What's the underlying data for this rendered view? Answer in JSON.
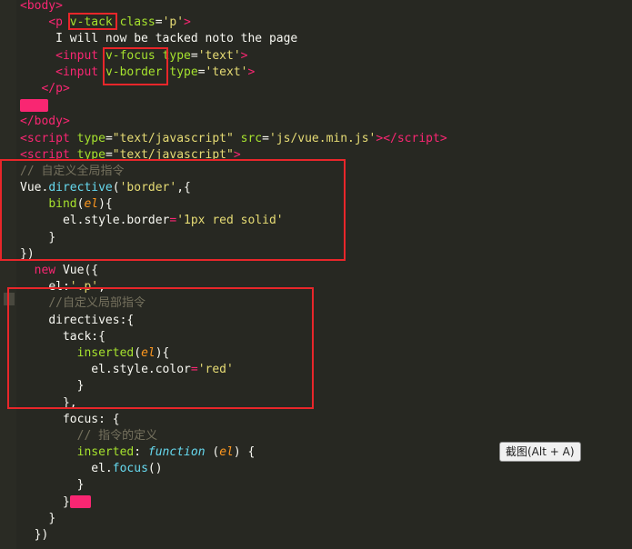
{
  "lines": [
    {
      "indent": "",
      "tokens": [
        [
          "tag",
          "<body>"
        ]
      ]
    },
    {
      "indent": "    ",
      "tokens": [
        [
          "tag",
          "<p "
        ],
        [
          "attr",
          "v-tack"
        ],
        [
          "plain",
          " "
        ],
        [
          "attr",
          "class"
        ],
        [
          "plain",
          "="
        ],
        [
          "str",
          "'p'"
        ],
        [
          "tag",
          ">"
        ]
      ]
    },
    {
      "indent": "     ",
      "tokens": [
        [
          "plain",
          "I will now be tacked noto the page"
        ]
      ]
    },
    {
      "indent": "     ",
      "tokens": [
        [
          "tag",
          "<input "
        ],
        [
          "attr",
          "v-focus"
        ],
        [
          "plain",
          " "
        ],
        [
          "attr",
          "type"
        ],
        [
          "plain",
          "="
        ],
        [
          "str",
          "'text'"
        ],
        [
          "tag",
          ">"
        ]
      ]
    },
    {
      "indent": "     ",
      "tokens": [
        [
          "tag",
          "<input "
        ],
        [
          "attr",
          "v-border"
        ],
        [
          "plain",
          " "
        ],
        [
          "attr",
          "type"
        ],
        [
          "plain",
          "="
        ],
        [
          "str",
          "'text'"
        ],
        [
          "tag",
          ">"
        ]
      ]
    },
    {
      "indent": "   ",
      "tokens": [
        [
          "tag",
          "</p>"
        ]
      ]
    },
    {
      "indent": "",
      "tokens": [
        [
          "mark",
          "...."
        ]
      ]
    },
    {
      "indent": "",
      "tokens": [
        [
          "tag",
          "</body>"
        ]
      ]
    },
    {
      "indent": "",
      "tokens": [
        [
          "tag",
          "<script "
        ],
        [
          "attr",
          "type"
        ],
        [
          "plain",
          "="
        ],
        [
          "str",
          "\"text/javascript\""
        ],
        [
          "plain",
          " "
        ],
        [
          "attr",
          "src"
        ],
        [
          "plain",
          "="
        ],
        [
          "str",
          "'js/vue.min.js'"
        ],
        [
          "tag",
          "></"
        ],
        [
          "tag",
          "script"
        ],
        [
          "tag",
          ">"
        ]
      ]
    },
    {
      "indent": "",
      "tokens": [
        [
          "tag",
          "<script "
        ],
        [
          "attr",
          "type"
        ],
        [
          "plain",
          "="
        ],
        [
          "str",
          "\"text/javascript\""
        ],
        [
          "tag",
          ">"
        ]
      ]
    },
    {
      "indent": "",
      "tokens": [
        [
          "comment",
          "// 自定义全局指令"
        ]
      ]
    },
    {
      "indent": "",
      "tokens": [
        [
          "plain",
          "Vue."
        ],
        [
          "fn",
          "directive"
        ],
        [
          "plain",
          "("
        ],
        [
          "str",
          "'border'"
        ],
        [
          "plain",
          ",{"
        ]
      ]
    },
    {
      "indent": "    ",
      "tokens": [
        [
          "attr",
          "bind"
        ],
        [
          "plain",
          "("
        ],
        [
          "param",
          "el"
        ],
        [
          "plain",
          "){"
        ]
      ]
    },
    {
      "indent": "      ",
      "tokens": [
        [
          "plain",
          "el.style.border"
        ],
        [
          "kw",
          "="
        ],
        [
          "str",
          "'1px red solid'"
        ]
      ]
    },
    {
      "indent": "    ",
      "tokens": [
        [
          "plain",
          "}"
        ]
      ]
    },
    {
      "indent": "",
      "tokens": [
        [
          "plain",
          "})"
        ]
      ]
    },
    {
      "indent": "  ",
      "tokens": [
        [
          "kw",
          "new "
        ],
        [
          "plain",
          "Vue({"
        ]
      ]
    },
    {
      "indent": "    ",
      "tokens": [
        [
          "plain",
          "el:"
        ],
        [
          "str",
          "'.p'"
        ],
        [
          "plain",
          ","
        ]
      ]
    },
    {
      "indent": "    ",
      "tokens": [
        [
          "comment",
          "//自定义局部指令"
        ]
      ]
    },
    {
      "indent": "    ",
      "tokens": [
        [
          "plain",
          "directives:{"
        ]
      ]
    },
    {
      "indent": "      ",
      "tokens": [
        [
          "plain",
          "tack:{"
        ]
      ]
    },
    {
      "indent": "        ",
      "tokens": [
        [
          "attr",
          "inserted"
        ],
        [
          "plain",
          "("
        ],
        [
          "param",
          "el"
        ],
        [
          "plain",
          "){"
        ]
      ]
    },
    {
      "indent": "          ",
      "tokens": [
        [
          "plain",
          "el.style.color"
        ],
        [
          "kw",
          "="
        ],
        [
          "str",
          "'red'"
        ]
      ]
    },
    {
      "indent": "        ",
      "tokens": [
        [
          "plain",
          "}"
        ]
      ]
    },
    {
      "indent": "      ",
      "tokens": [
        [
          "plain",
          "},"
        ]
      ]
    },
    {
      "indent": "      ",
      "tokens": [
        [
          "plain",
          "focus: {"
        ]
      ]
    },
    {
      "indent": "        ",
      "tokens": [
        [
          "comment",
          "// 指令的定义"
        ]
      ]
    },
    {
      "indent": "        ",
      "tokens": [
        [
          "attr",
          "inserted"
        ],
        [
          "plain",
          ": "
        ],
        [
          "italic-kw",
          "function"
        ],
        [
          "plain",
          " ("
        ],
        [
          "param",
          "el"
        ],
        [
          "plain",
          ") {"
        ]
      ]
    },
    {
      "indent": "          ",
      "tokens": [
        [
          "plain",
          "el."
        ],
        [
          "fn",
          "focus"
        ],
        [
          "plain",
          "()"
        ]
      ]
    },
    {
      "indent": "        ",
      "tokens": [
        [
          "plain",
          "}"
        ]
      ]
    },
    {
      "indent": "      ",
      "tokens": [
        [
          "plain",
          "}"
        ],
        [
          "mark",
          "---"
        ]
      ]
    },
    {
      "indent": "    ",
      "tokens": [
        [
          "plain",
          "}"
        ]
      ]
    },
    {
      "indent": "  ",
      "tokens": [
        [
          "plain",
          "})"
        ]
      ]
    }
  ],
  "tooltip": {
    "text": "截图(Alt + A)"
  }
}
